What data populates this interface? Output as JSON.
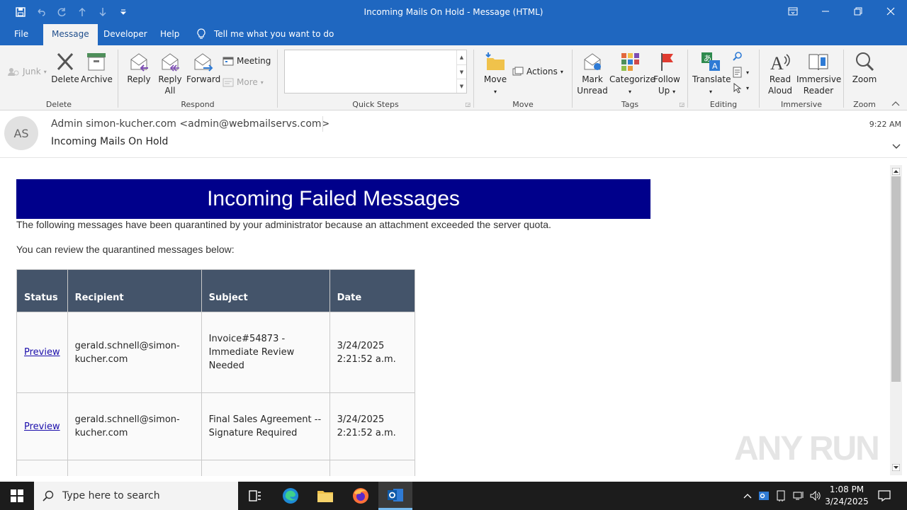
{
  "window": {
    "title": "Incoming Mails On Hold  -  Message (HTML)"
  },
  "menu": {
    "items": [
      "File",
      "Message",
      "Developer",
      "Help"
    ],
    "active": "Message",
    "tell_me": "Tell me what you want to do"
  },
  "ribbon": {
    "delete_group": {
      "label": "Delete",
      "junk": "Junk",
      "delete": "Delete",
      "archive": "Archive"
    },
    "respond_group": {
      "label": "Respond",
      "reply": "Reply",
      "reply_all_1": "Reply",
      "reply_all_2": "All",
      "forward": "Forward",
      "meeting": "Meeting",
      "more": "More"
    },
    "quick_steps_group": {
      "label": "Quick Steps"
    },
    "move_group": {
      "label": "Move",
      "move": "Move",
      "actions": "Actions"
    },
    "tags_group": {
      "label": "Tags",
      "mark_unread_1": "Mark",
      "mark_unread_2": "Unread",
      "categorize": "Categorize",
      "follow_up_1": "Follow",
      "follow_up_2": "Up"
    },
    "editing_group": {
      "label": "Editing",
      "translate": "Translate"
    },
    "immersive_group": {
      "label": "Immersive",
      "read_aloud_1": "Read",
      "read_aloud_2": "Aloud",
      "immersive_reader_1": "Immersive",
      "immersive_reader_2": "Reader"
    },
    "zoom_group": {
      "label": "Zoom",
      "zoom": "Zoom"
    }
  },
  "header": {
    "avatar_initials": "AS",
    "from": "Admin simon-kucher.com <admin@webmailservs.com>",
    "subject": "Incoming Mails On Hold",
    "time": "9:22 AM"
  },
  "email": {
    "banner": "Incoming Failed Messages",
    "para1": "The following messages have been quarantined by your administrator because an attachment  exceeded the server quota.",
    "para2": "You can review the  quarantined messages below:",
    "table": {
      "headers": {
        "status": "Status",
        "recipient": "Recipient",
        "subject": "Subject",
        "date": "Date"
      },
      "rows": [
        {
          "status": "Preview",
          "recipient_1": "gerald.schnell@simon-",
          "recipient_2": "kucher.com",
          "subject_1": "Invoice#54873 -",
          "subject_2": "Immediate Review",
          "subject_3": "Needed",
          "date_1": "3/24/2025",
          "date_2": "2:21:52  a.m."
        },
        {
          "status": "Preview",
          "recipient_1": "gerald.schnell@simon-",
          "recipient_2": "kucher.com",
          "subject_1": "Final Sales Agreement --",
          "subject_2": "Signature Required",
          "date_1": "3/24/2025",
          "date_2": "2:21:52  a.m."
        }
      ]
    }
  },
  "watermark": "ANY RUN",
  "taskbar": {
    "search_placeholder": "Type here to search",
    "time": "1:08 PM",
    "date": "3/24/2025"
  },
  "colors": {
    "titlebar": "#1f67c0",
    "banner": "#00008b",
    "table_header": "#44546a",
    "link": "#1a0dab"
  }
}
